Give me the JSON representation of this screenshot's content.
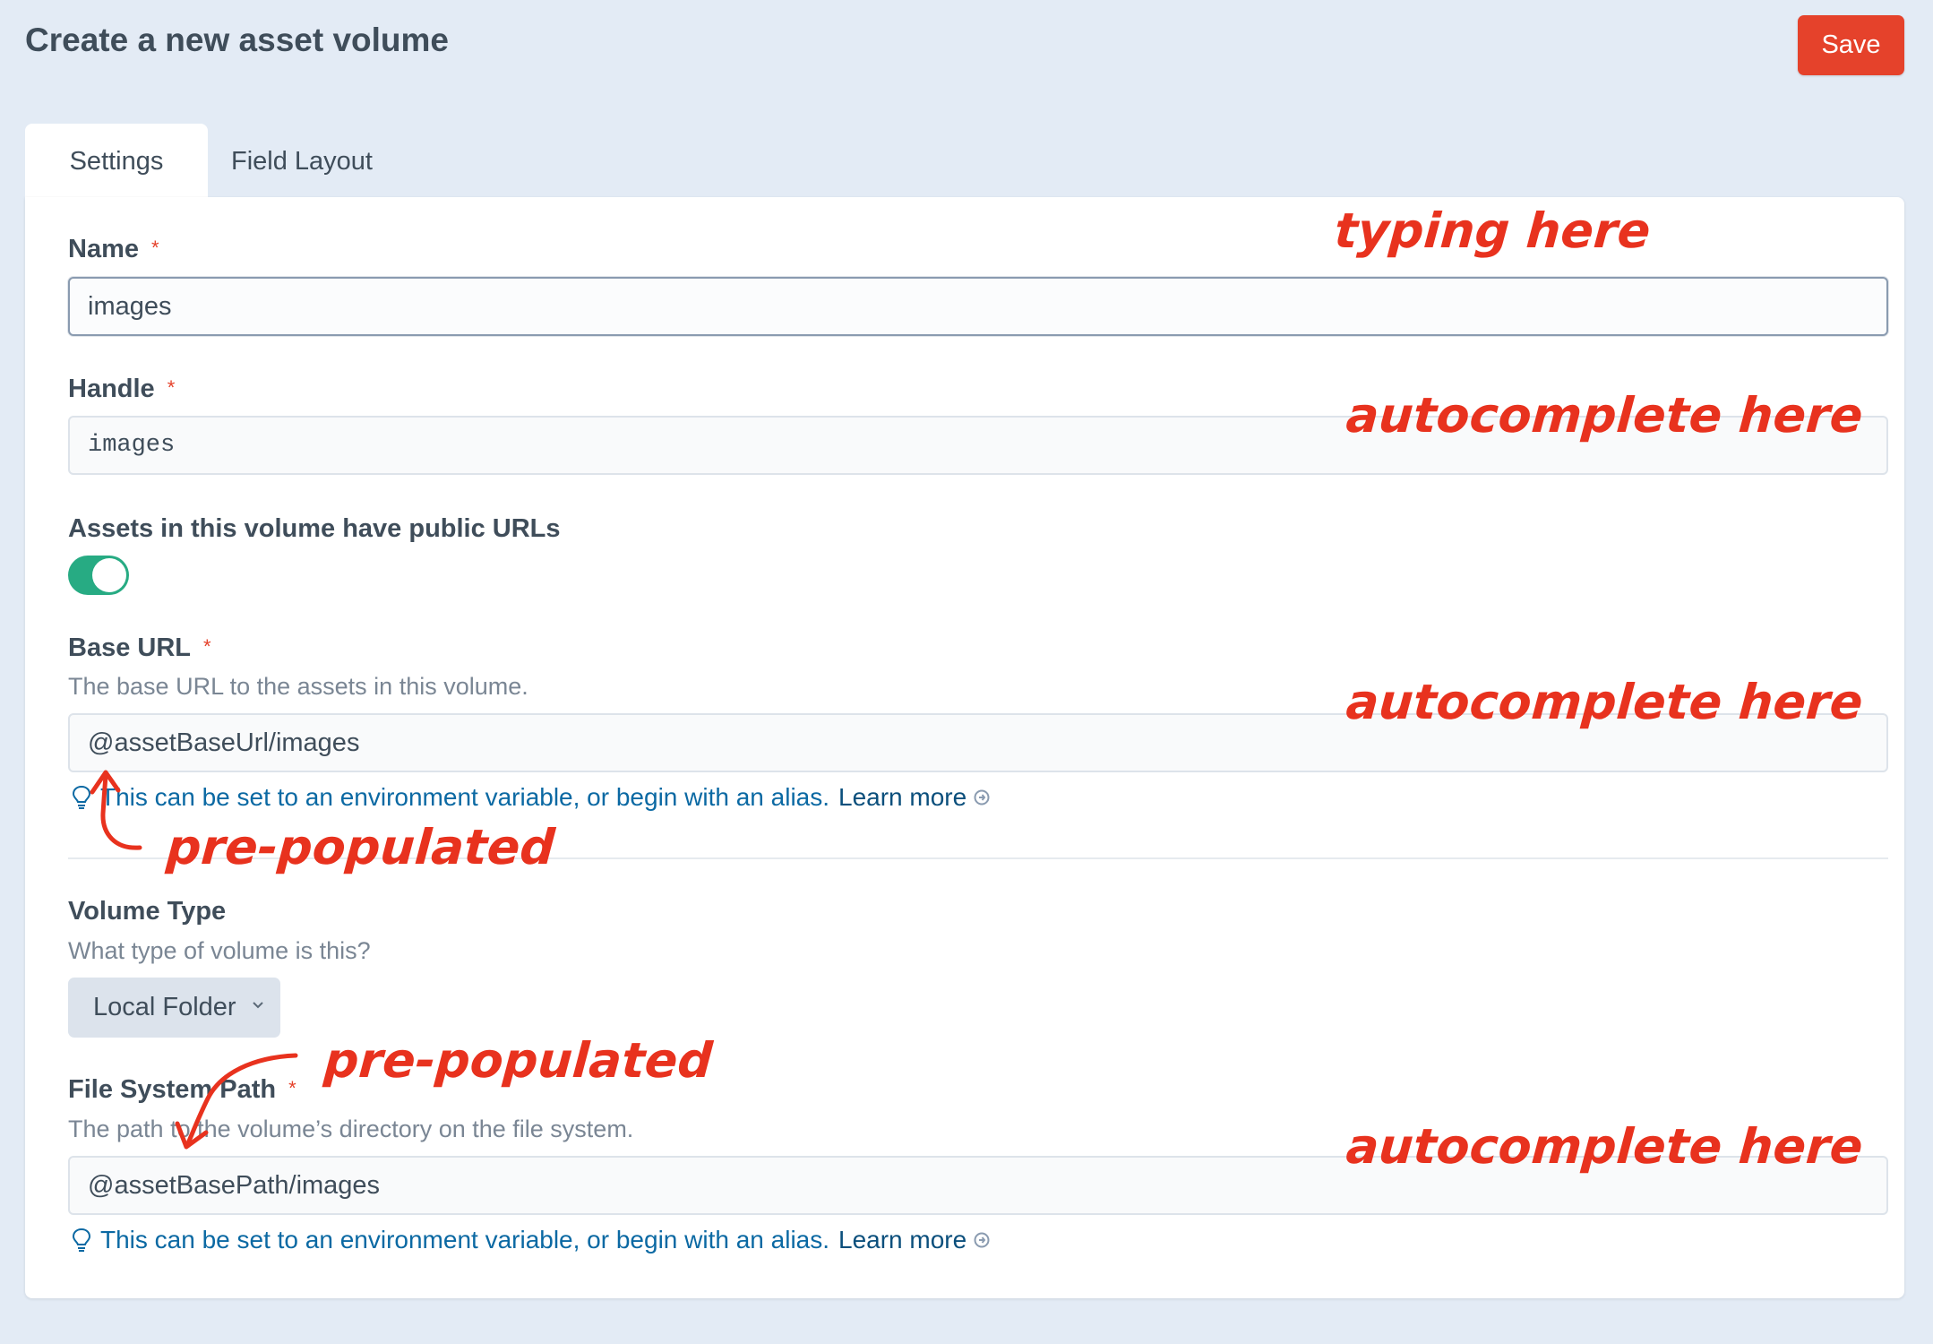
{
  "header": {
    "title": "Create a new asset volume",
    "save_label": "Save"
  },
  "tabs": [
    {
      "label": "Settings"
    },
    {
      "label": "Field Layout"
    }
  ],
  "fields": {
    "name": {
      "label": "Name",
      "value": "images"
    },
    "handle": {
      "label": "Handle",
      "value": "images"
    },
    "public_urls": {
      "label": "Assets in this volume have public URLs",
      "enabled": true
    },
    "base_url": {
      "label": "Base URL",
      "instructions": "The base URL to the assets in this volume.",
      "value": "@assetBaseUrl/images",
      "tip": "This can be set to an environment variable, or begin with an alias.",
      "learn_more": "Learn more"
    },
    "volume_type": {
      "label": "Volume Type",
      "instructions": "What type of volume is this?",
      "selected": "Local Folder"
    },
    "fs_path": {
      "label": "File System Path",
      "instructions": "The path to the volume’s directory on the file system.",
      "value": "@assetBasePath/images",
      "tip": "This can be set to an environment variable, or begin with an alias.",
      "learn_more": "Learn more"
    }
  },
  "required_marker": "*",
  "annotations": {
    "typing": "typing here",
    "autocomplete_handle": "autocomplete here",
    "autocomplete_base_url": "autocomplete here",
    "prepopulated_base_url": "pre-populated",
    "prepopulated_fs_path": "pre-populated",
    "autocomplete_fs_path": "autocomplete here"
  },
  "colors": {
    "accent": "#e5422b",
    "toggle_on": "#27ab83",
    "link": "#0b69a3",
    "annotation": "#e8321e",
    "background": "#e3ebf5"
  },
  "icons": [
    "lightbulb-icon",
    "arrow-circle-icon",
    "chevron-down-icon",
    "annotation-arrow-icon"
  ]
}
